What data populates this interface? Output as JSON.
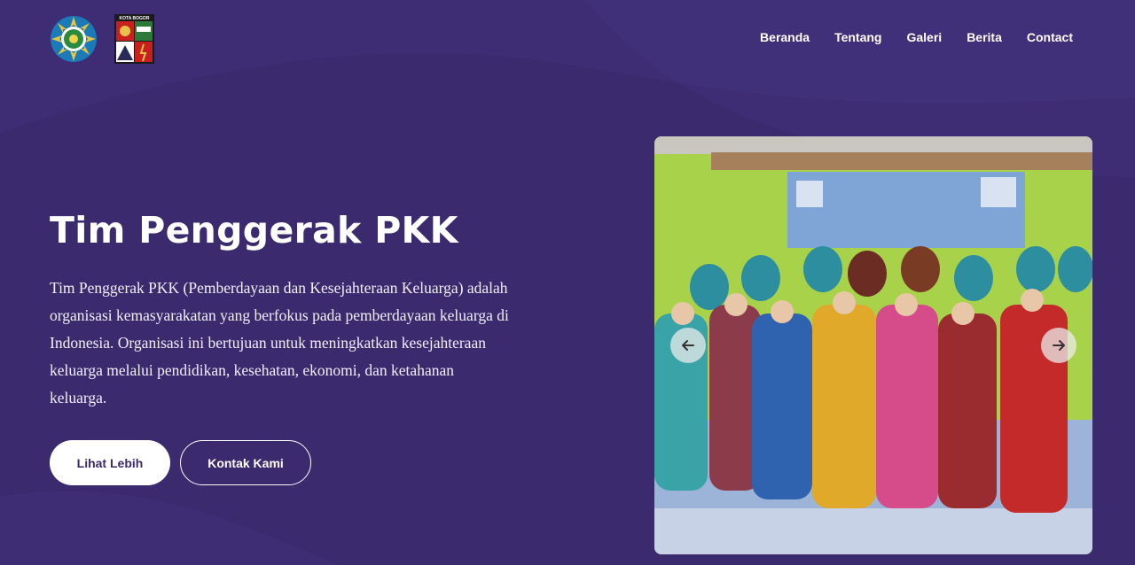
{
  "header": {
    "logos": [
      {
        "name": "pkk-logo"
      },
      {
        "name": "kota-bogor-logo",
        "text": "KOTA BOGOR"
      }
    ],
    "nav": [
      "Beranda",
      "Tentang",
      "Galeri",
      "Berita",
      "Contact"
    ]
  },
  "hero": {
    "title": "Tim Penggerak PKK",
    "description": "Tim Penggerak PKK (Pemberdayaan dan Kesejahteraan Keluarga) adalah organisasi kemasyarakatan yang berfokus pada pemberdayaan keluarga di Indonesia. Organisasi ini bertujuan untuk meningkatkan kesejahteraan keluarga melalui pendidikan, kesehatan, ekonomi, dan ketahanan keluarga.",
    "buttons": {
      "primary": "Lihat Lebih",
      "secondary": "Kontak Kami"
    }
  },
  "carousel": {
    "prev_icon": "arrow-left-icon",
    "next_icon": "arrow-right-icon"
  },
  "colors": {
    "background": "#3b2a6e",
    "text": "#ffffff",
    "button_text": "#3b2a6e"
  }
}
